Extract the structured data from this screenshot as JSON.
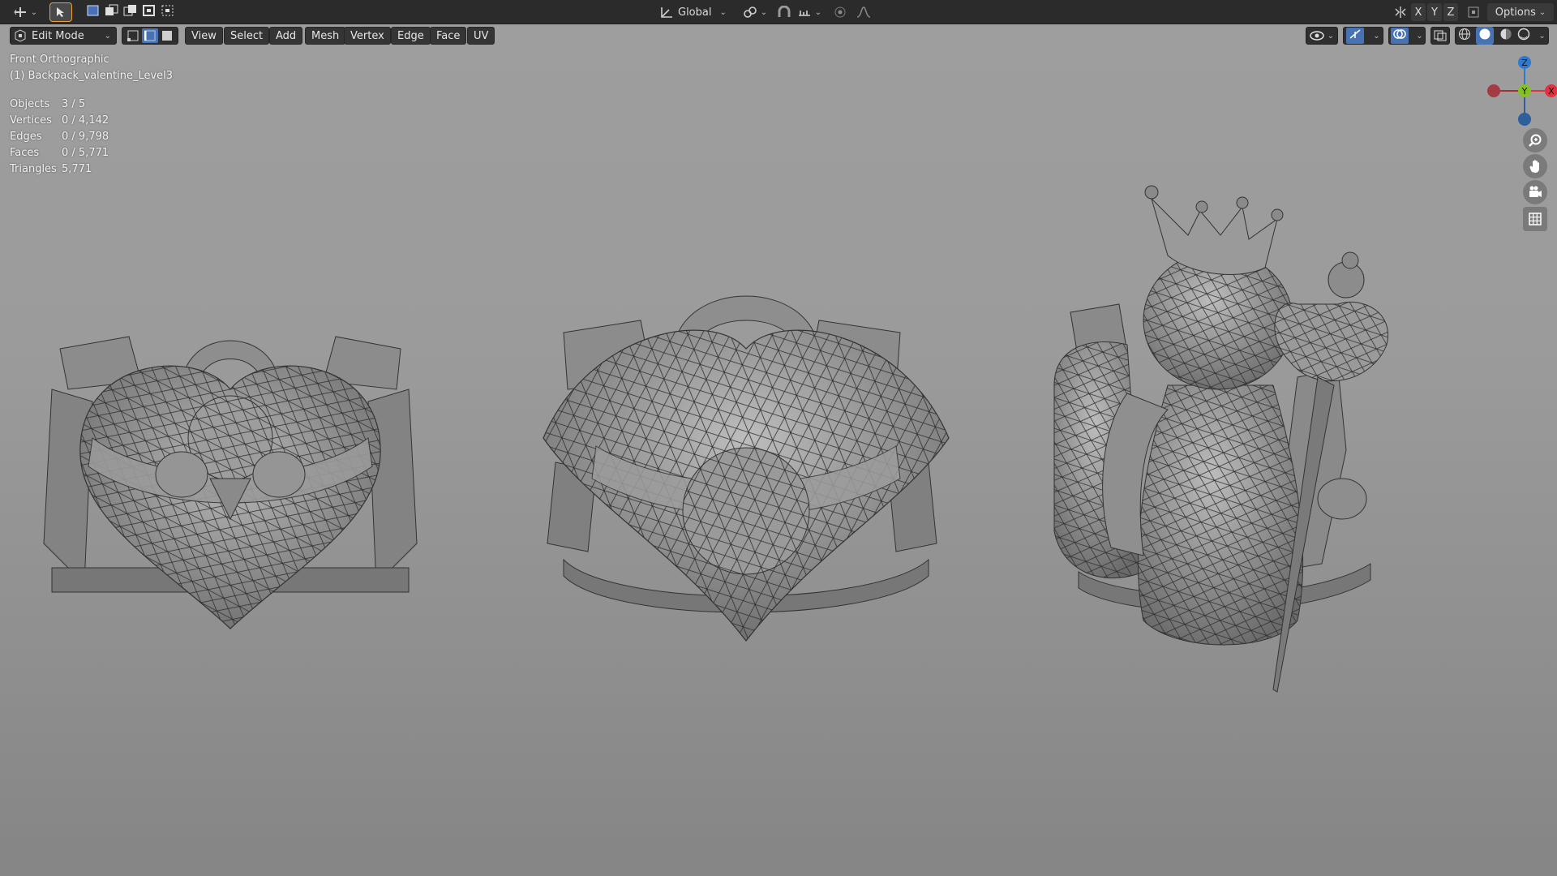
{
  "topbar": {
    "orientation": "Global",
    "axis_x": "X",
    "axis_y": "Y",
    "axis_z": "Z",
    "options_label": "Options"
  },
  "header": {
    "mode": "Edit Mode",
    "menus": [
      "View",
      "Select",
      "Add",
      "Mesh",
      "Vertex",
      "Edge",
      "Face",
      "UV"
    ]
  },
  "viewport": {
    "view_name": "Front Orthographic",
    "object_name": "(1) Backpack_valentine_Level3",
    "stats": [
      {
        "label": "Objects",
        "value": "3 / 5"
      },
      {
        "label": "Vertices",
        "value": "0 / 4,142"
      },
      {
        "label": "Edges",
        "value": "0 / 9,798"
      },
      {
        "label": "Faces",
        "value": "0 / 5,771"
      },
      {
        "label": "Triangles",
        "value": "5,771"
      }
    ]
  },
  "gizmo": {
    "z_label": "Z",
    "y_label": "Y",
    "x_label": "X",
    "colors": {
      "x": "#e0333f",
      "y": "#84c224",
      "z": "#2e7ad1"
    }
  },
  "icons": [
    "transform-icon",
    "select-box-icon",
    "pivot-icon",
    "snap-icon",
    "proportional-icon",
    "visibility-icon",
    "gizmo-icon",
    "overlay-icon",
    "xray-icon",
    "wireframe-shading-icon",
    "solid-shading-icon",
    "material-shading-icon",
    "rendered-shading-icon",
    "zoom-icon",
    "pan-hand-icon",
    "camera-icon",
    "grid-icon"
  ]
}
